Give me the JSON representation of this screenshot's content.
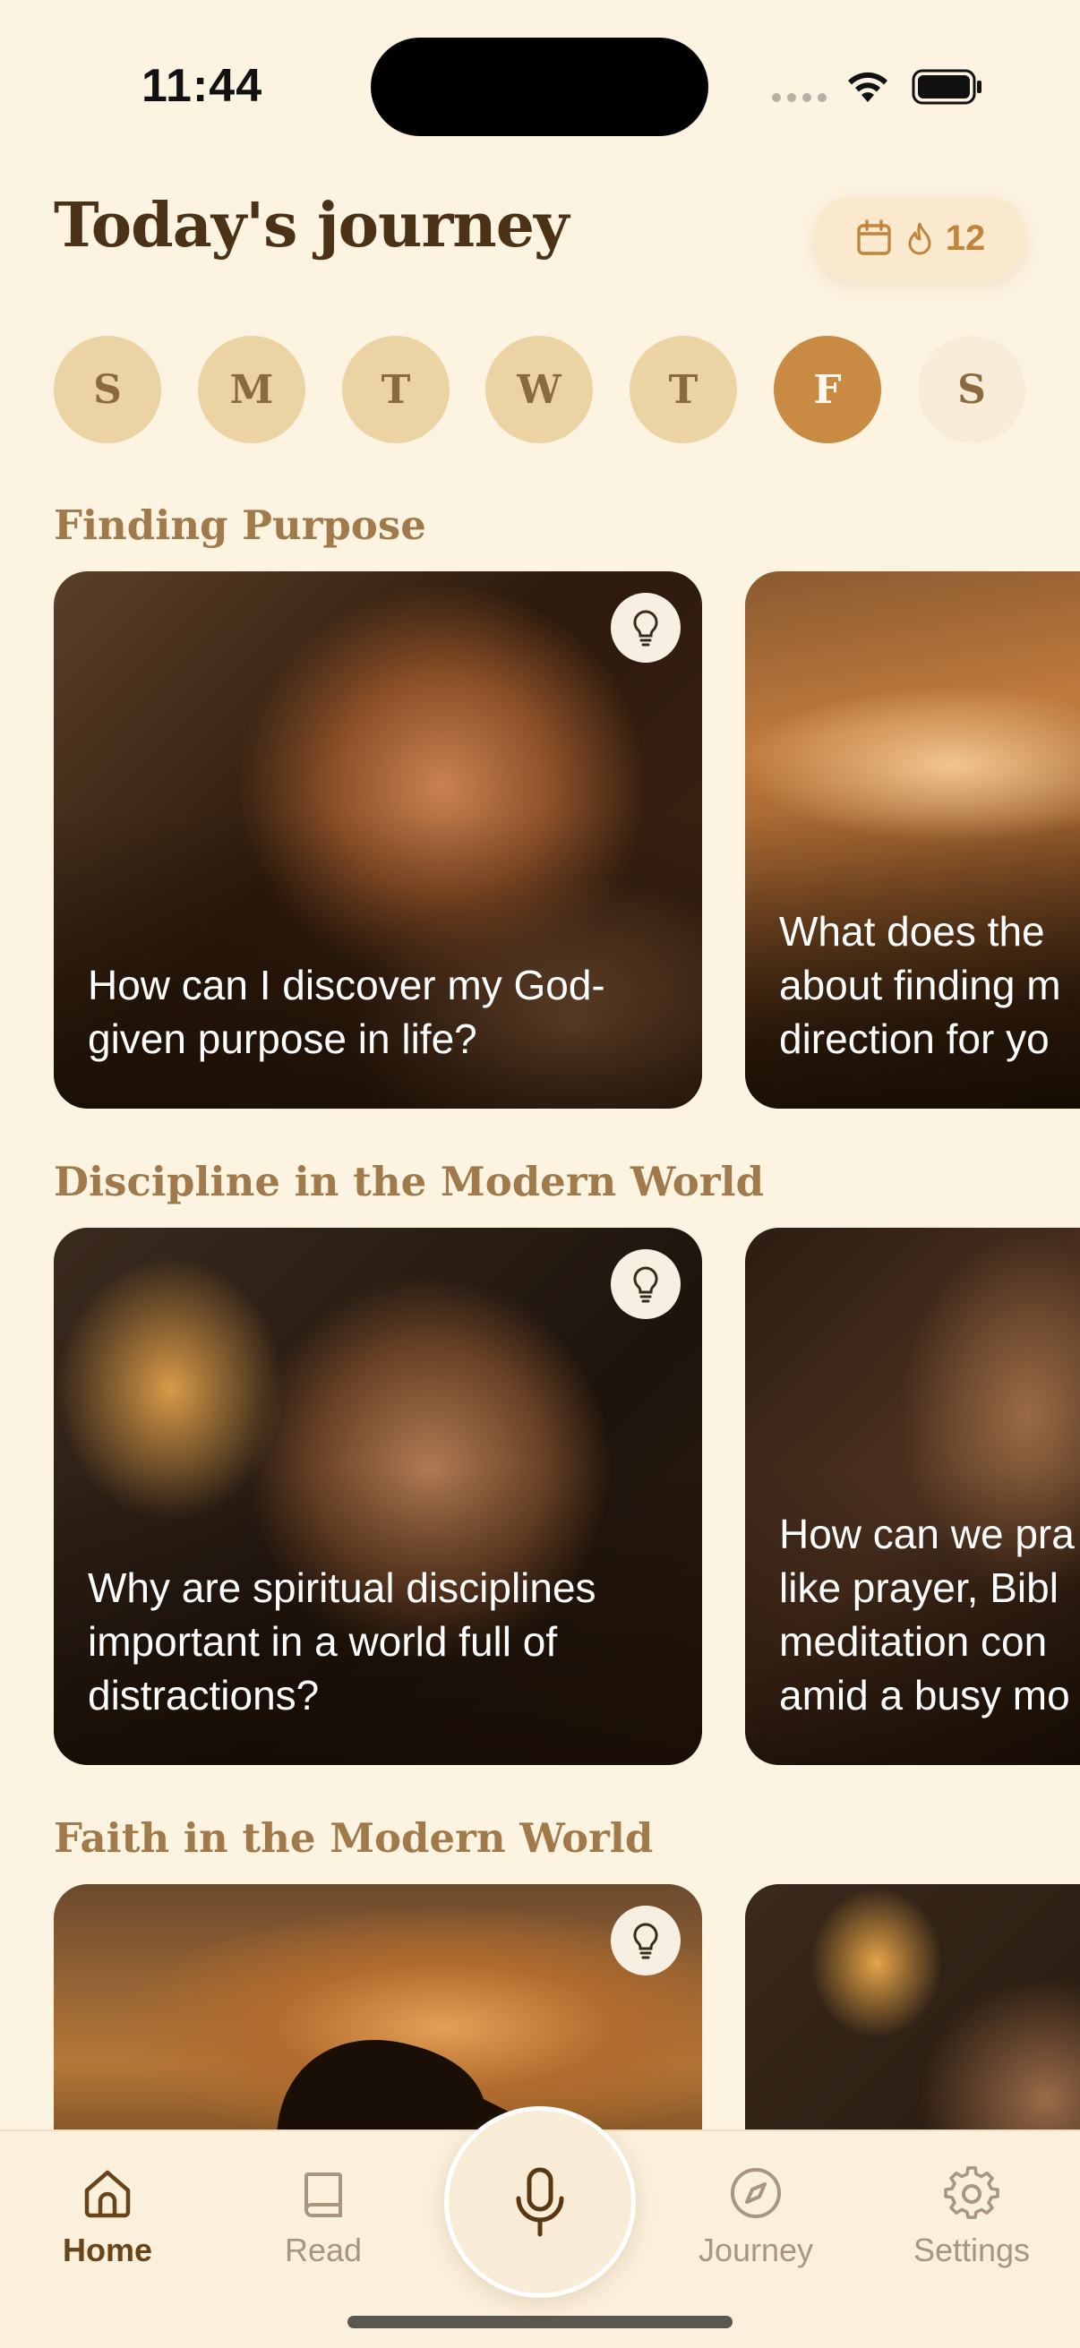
{
  "status_bar": {
    "time": "11:44"
  },
  "header": {
    "title": "Today's journey",
    "streak_count": "12"
  },
  "days": [
    {
      "letter": "S",
      "state": "past"
    },
    {
      "letter": "M",
      "state": "past"
    },
    {
      "letter": "T",
      "state": "past"
    },
    {
      "letter": "W",
      "state": "past"
    },
    {
      "letter": "T",
      "state": "past"
    },
    {
      "letter": "F",
      "state": "today"
    },
    {
      "letter": "S",
      "state": "future"
    }
  ],
  "sections": [
    {
      "title": "Finding Purpose",
      "cards": [
        {
          "caption": "How can I discover my God-\ngiven purpose in life?"
        },
        {
          "caption": "What does the\nabout finding m\ndirection for yo"
        }
      ]
    },
    {
      "title": "Discipline in the Modern World",
      "cards": [
        {
          "caption": "Why are spiritual disciplines\nimportant in a world full of\ndistractions?"
        },
        {
          "caption": "How can we pra\nlike prayer, Bibl\nmeditation con\namid a busy mo"
        }
      ]
    },
    {
      "title": "Faith in the Modern World",
      "cards": [
        {
          "caption": ""
        },
        {
          "caption": ""
        }
      ]
    }
  ],
  "tabbar": {
    "home": "Home",
    "read": "Read",
    "journey": "Journey",
    "settings": "Settings"
  },
  "icons": {
    "streak_calendar": "calendar-icon",
    "streak_flame": "flame-icon",
    "card_hint": "lightbulb-icon",
    "mic": "microphone-icon"
  },
  "colors": {
    "background": "#fdf3e1",
    "accent": "#c98a43",
    "title": "#4b3216",
    "section_title": "#a17a4c"
  }
}
